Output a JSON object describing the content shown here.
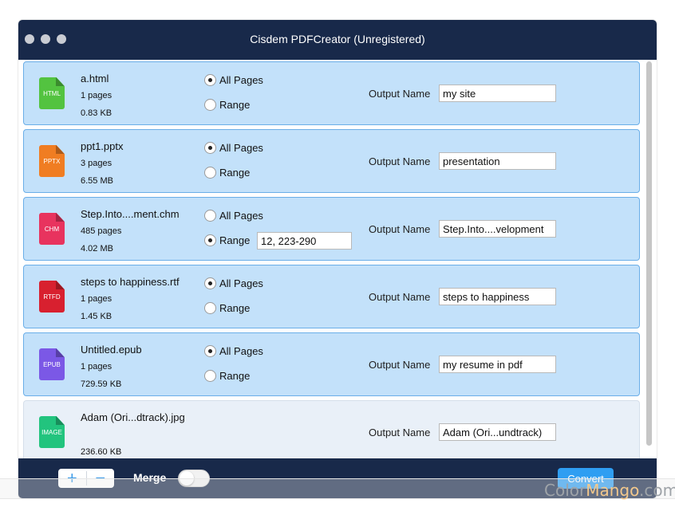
{
  "window": {
    "title": "Cisdem PDFCreator (Unregistered)"
  },
  "colors": {
    "titlebar": "#18294a",
    "row_selected": "#c3e1fa",
    "row_border": "#6aaee8",
    "convert_button": "#2f9ef2"
  },
  "options": {
    "all_pages_label": "All Pages",
    "range_label": "Range",
    "output_name_label": "Output Name"
  },
  "files": [
    {
      "type": "HTML",
      "icon_color": "#53c340",
      "name": "a.html",
      "pages": "1 pages",
      "size": "0.83 KB",
      "mode": "all",
      "range": "",
      "output": "my site",
      "selected": true
    },
    {
      "type": "PPTX",
      "icon_color": "#f07d22",
      "name": "ppt1.pptx",
      "pages": "3 pages",
      "size": "6.55 MB",
      "mode": "all",
      "range": "",
      "output": "presentation",
      "selected": true
    },
    {
      "type": "CHM",
      "icon_color": "#e8335e",
      "name": "Step.Into....ment.chm",
      "pages": "485 pages",
      "size": "4.02 MB",
      "mode": "range",
      "range": "12, 223-290",
      "output": "Step.Into....velopment",
      "selected": true
    },
    {
      "type": "RTFD",
      "icon_color": "#d8202f",
      "name": "steps to happiness.rtf",
      "pages": "1 pages",
      "size": "1.45 KB",
      "mode": "all",
      "range": "",
      "output": "steps to happiness",
      "selected": true
    },
    {
      "type": "EPUB",
      "icon_color": "#7b58e6",
      "name": "Untitled.epub",
      "pages": "1 pages",
      "size": "729.59 KB",
      "mode": "all",
      "range": "",
      "output": "my resume in pdf",
      "selected": true
    },
    {
      "type": "IMAGE",
      "icon_color": "#22c47e",
      "name": "Adam (Ori...dtrack).jpg",
      "pages": "",
      "size": "236.60 KB",
      "mode": "none",
      "range": "",
      "output": "Adam (Ori...undtrack)",
      "selected": false
    }
  ],
  "toolbar": {
    "add_symbol": "+",
    "remove_symbol": "−",
    "merge_label": "Merge",
    "merge_on": false,
    "convert_label": "Convert"
  },
  "watermark": {
    "part1": "Color",
    "part2": "Mango",
    "part3": ".com"
  }
}
